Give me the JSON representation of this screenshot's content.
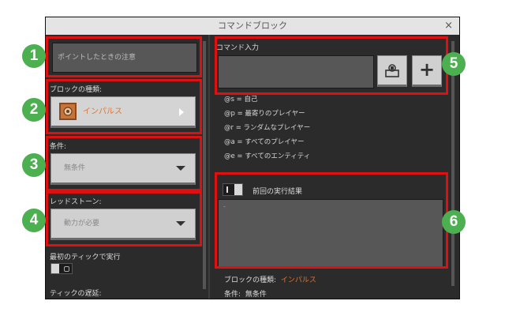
{
  "window": {
    "title": "コマンドブロック",
    "close": "×"
  },
  "left": {
    "hover_note_placeholder": "ポイントしたときの注意",
    "block_type": {
      "label": "ブロックの種類:",
      "value": "インパルス",
      "icon": "impulse-block-icon",
      "value_color": "#d9773a"
    },
    "condition": {
      "label": "条件:",
      "value": "無条件"
    },
    "redstone": {
      "label": "レッドストーン:",
      "value": "動力が必要"
    },
    "execute_first_tick": {
      "label": "最初のティックで実行"
    },
    "tick_delay": {
      "label": "ティックの遅延:"
    }
  },
  "right": {
    "command_input": {
      "label": "コマンド入力",
      "value": ""
    },
    "buttons": {
      "suggest_icon": "command-suggest-icon",
      "add": "+"
    },
    "selectors": [
      "@s = 自己",
      "@p = 最寄りのプレイヤー",
      "@r = ランダムなプレイヤー",
      "@a = すべてのプレイヤー",
      "@e = すべてのエンティティ"
    ],
    "previous_output": {
      "label": "前回の実行結果",
      "value": "-"
    },
    "summary": [
      {
        "label": "ブロックの種類:",
        "value": "インパルス"
      },
      {
        "label": "条件:",
        "value": "無条件"
      }
    ]
  },
  "callouts": [
    "1",
    "2",
    "3",
    "4",
    "5",
    "6"
  ],
  "colors": {
    "highlight": "#e01010",
    "badge": "#4caf50",
    "accent": "#d9773a"
  }
}
